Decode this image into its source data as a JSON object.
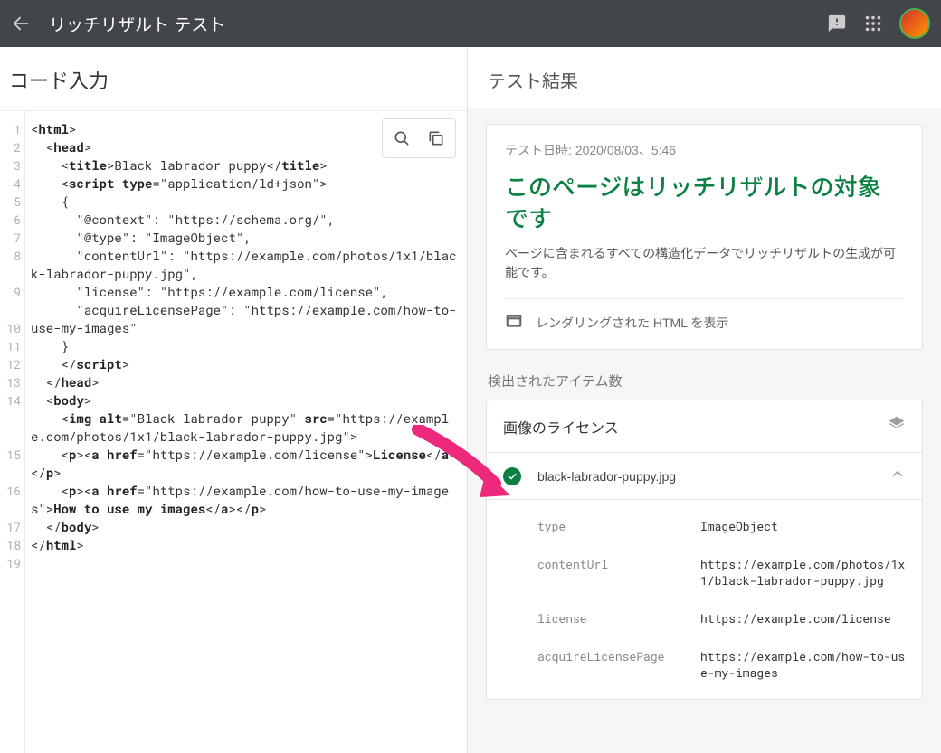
{
  "header": {
    "title": "リッチリザルト テスト"
  },
  "left": {
    "title": "コード入力",
    "line_numbers": [
      "1",
      "2",
      "3",
      "4",
      "5",
      "6",
      "7",
      "8",
      "9",
      "10",
      "11",
      "12",
      "13",
      "14",
      "15",
      "16",
      "17",
      "18",
      "19"
    ]
  },
  "code": {
    "line1_open": "<",
    "line1_tag": "html",
    "line1_close": ">",
    "line2_open": "  <",
    "line2_tag": "head",
    "line2_close": ">",
    "line3_a": "    <",
    "line3_tag1": "title",
    "line3_b": ">Black labrador puppy</",
    "line3_tag2": "title",
    "line3_c": ">",
    "line4_a": "    <",
    "line4_tag": "script",
    "line4_b": " ",
    "line4_attr": "type",
    "line4_c": "=\"application/ld+json\">",
    "line5": "    {",
    "line6": "      \"@context\": \"https://schema.org/\",",
    "line7": "      \"@type\": \"ImageObject\",",
    "line8": "      \"contentUrl\": \"https://example.com/photos/1x1/black-labrador-puppy.jpg\",",
    "line9": "      \"license\": \"https://example.com/license\",",
    "line10": "      \"acquireLicensePage\": \"https://example.com/how-to-use-my-images\"",
    "line11": "    }",
    "line12_a": "    </",
    "line12_tag": "script",
    "line12_b": ">",
    "line13_a": "  </",
    "line13_tag": "head",
    "line13_b": ">",
    "line14_a": "  <",
    "line14_tag": "body",
    "line14_b": ">",
    "line15_a": "    <",
    "line15_tag": "img",
    "line15_b": " ",
    "line15_attr1": "alt",
    "line15_c": "=\"Black labrador puppy\" ",
    "line15_attr2": "src",
    "line15_d": "=\"https://example.com/photos/1x1/black-labrador-puppy.jpg\">",
    "line16_a": "    <",
    "line16_p1": "p",
    "line16_b": "><",
    "line16_a1": "a",
    "line16_c": " ",
    "line16_href": "href",
    "line16_d": "=\"https://example.com/license\">",
    "line16_txt": "License",
    "line16_e": "</",
    "line16_a2": "a",
    "line16_f": "></",
    "line16_p2": "p",
    "line16_g": ">",
    "line17_a": "    <",
    "line17_p1": "p",
    "line17_b": "><",
    "line17_a1": "a",
    "line17_c": " ",
    "line17_href": "href",
    "line17_d": "=\"https://example.com/how-to-use-my-images\">",
    "line17_txt": "How to use my images",
    "line17_e": "</",
    "line17_a2": "a",
    "line17_f": "></",
    "line17_p2": "p",
    "line17_g": ">",
    "line18_a": "  </",
    "line18_tag": "body",
    "line18_b": ">",
    "line19_a": "</",
    "line19_tag": "html",
    "line19_b": ">"
  },
  "right": {
    "title": "テスト結果",
    "timestamp": "テスト日時: 2020/08/03、5:46",
    "eligible_title": "このページはリッチリザルトの対象です",
    "eligible_desc": "ページに含まれるすべての構造化データでリッチリザルトの生成が可能です。",
    "rendered_html_label": "レンダリングされた HTML を表示",
    "detected_items_label": "検出されたアイテム数",
    "item": {
      "title": "画像のライセンス",
      "file": "black-labrador-puppy.jpg",
      "props": [
        {
          "key": "type",
          "value": "ImageObject"
        },
        {
          "key": "contentUrl",
          "value": "https://example.com/photos/1x1/black-labrador-puppy.jpg"
        },
        {
          "key": "license",
          "value": "https://example.com/license"
        },
        {
          "key": "acquireLicensePage",
          "value": "https://example.com/how-to-use-my-images"
        }
      ]
    }
  }
}
